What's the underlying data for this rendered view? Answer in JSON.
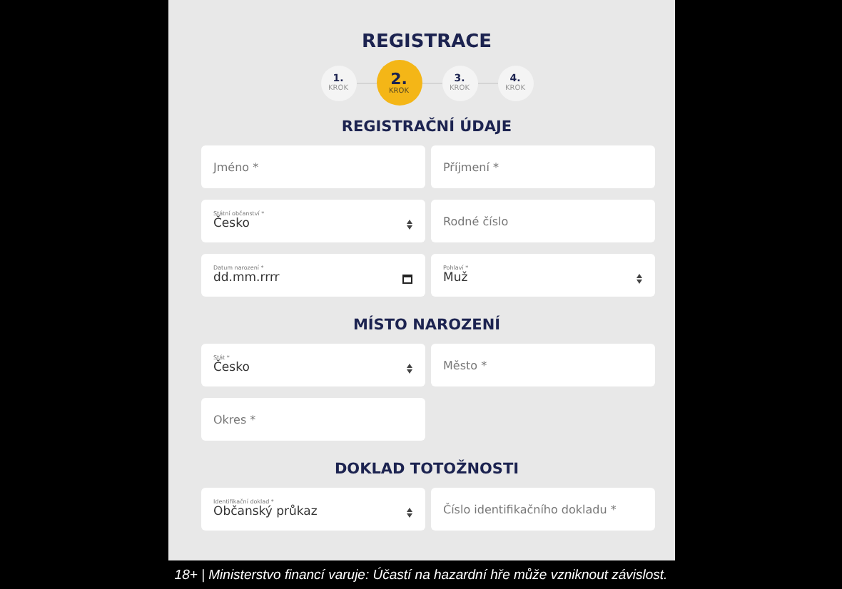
{
  "title": "REGISTRACE",
  "steps": [
    {
      "number": "1.",
      "label": "KROK",
      "selected": false
    },
    {
      "number": "2.",
      "label": "KROK",
      "selected": true
    },
    {
      "number": "3.",
      "label": "KROK",
      "selected": false
    },
    {
      "number": "4.",
      "label": "KROK",
      "selected": false
    }
  ],
  "sections": [
    {
      "heading": "REGISTRAČNÍ ÚDAJE",
      "fields": [
        {
          "kind": "text",
          "placeholder": "Jméno *"
        },
        {
          "kind": "text",
          "placeholder": "Příjmení *"
        },
        {
          "kind": "select",
          "label": "Státní občanství *",
          "value": "Česko"
        },
        {
          "kind": "text",
          "placeholder": "Rodné číslo"
        },
        {
          "kind": "date",
          "label": "Datum narození *",
          "value": "dd.mm.rrrr"
        },
        {
          "kind": "select",
          "label": "Pohlaví *",
          "value": "Muž"
        }
      ]
    },
    {
      "heading": "MÍSTO NAROZENÍ",
      "fields": [
        {
          "kind": "select",
          "label": "Stát *",
          "value": "Česko"
        },
        {
          "kind": "text",
          "placeholder": "Město *"
        },
        {
          "kind": "text",
          "placeholder": "Okres *"
        }
      ]
    },
    {
      "heading": "DOKLAD TOTOŽNOSTI",
      "fields": [
        {
          "kind": "select",
          "label": "Identifikační doklad *",
          "value": "Občanský průkaz"
        },
        {
          "kind": "text",
          "placeholder": "Číslo identifikačního dokladu *"
        }
      ]
    }
  ],
  "warning": "18+ | Ministerstvo financí varuje: Účastí na hazardní hře může vzniknout závislost."
}
